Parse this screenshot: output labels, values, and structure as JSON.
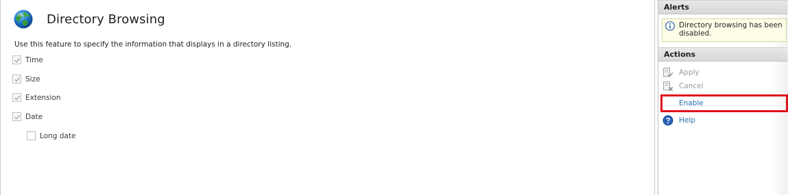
{
  "page": {
    "title": "Directory Browsing",
    "description": "Use this feature to specify the information that displays in a directory listing.",
    "options": [
      {
        "label": "Time",
        "checked": true,
        "enabled": false
      },
      {
        "label": "Size",
        "checked": true,
        "enabled": false
      },
      {
        "label": "Extension",
        "checked": true,
        "enabled": false
      },
      {
        "label": "Date",
        "checked": true,
        "enabled": false
      },
      {
        "label": "Long date",
        "checked": false,
        "enabled": false
      }
    ]
  },
  "alerts": {
    "header": "Alerts",
    "message": "Directory browsing has been disabled.",
    "icon": "info-icon"
  },
  "actions": {
    "header": "Actions",
    "items": [
      {
        "label": "Apply",
        "icon": "apply-icon",
        "enabled": false
      },
      {
        "label": "Cancel",
        "icon": "cancel-icon",
        "enabled": false
      },
      {
        "label": "Enable",
        "icon": "",
        "enabled": true
      },
      {
        "label": "Help",
        "icon": "help-icon",
        "enabled": true
      }
    ]
  },
  "colors": {
    "link": "#2a6fb0",
    "disabled_text": "#9a9a9a",
    "highlight": "#e0101c",
    "alert_background": "#fefee8"
  }
}
